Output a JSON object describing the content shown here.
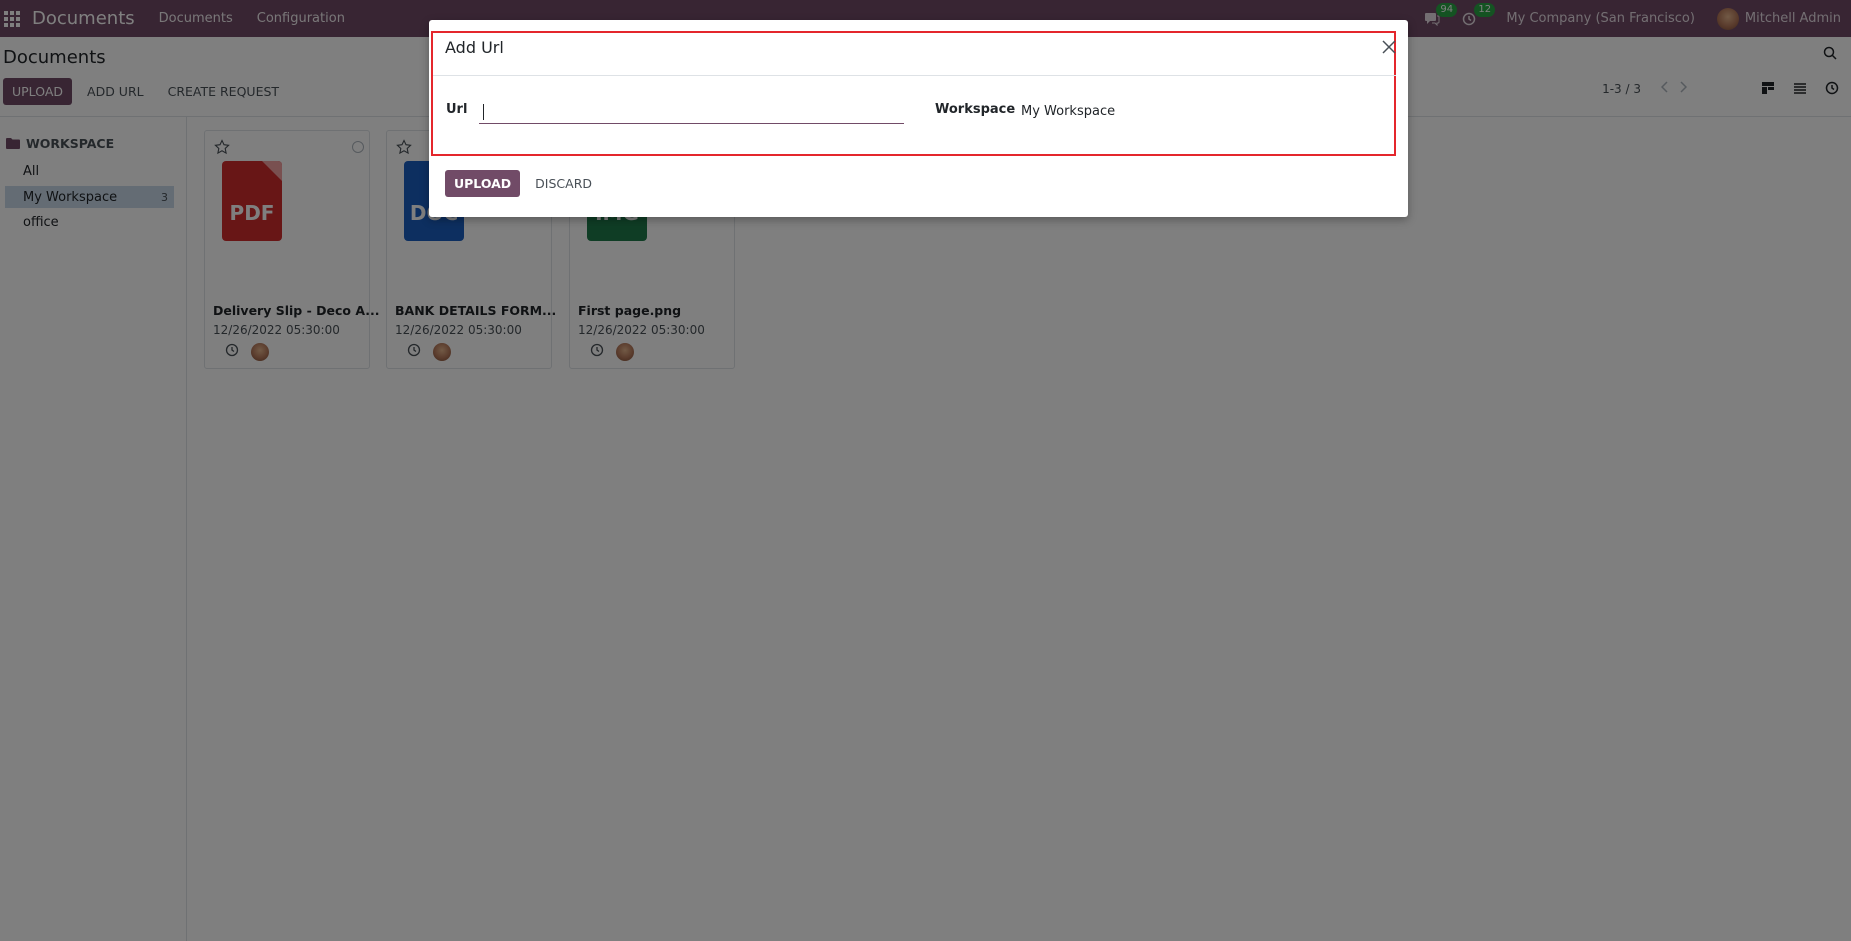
{
  "navbar": {
    "app_title": "Documents",
    "menu": [
      "Documents",
      "Configuration"
    ],
    "messages_count": "94",
    "activities_count": "12",
    "company": "My Company (San Francisco)",
    "user": "Mitchell Admin",
    "bg_color": "#714b67"
  },
  "control_panel": {
    "title": "Documents",
    "buttons": {
      "upload": "UPLOAD",
      "add_url": "ADD URL",
      "create_request": "CREATE REQUEST"
    },
    "pager": "1-3 / 3"
  },
  "sidebar": {
    "header": "WORKSPACE",
    "items": [
      {
        "label": "All",
        "count": ""
      },
      {
        "label": "My Workspace",
        "count": "3"
      },
      {
        "label": "office",
        "count": ""
      }
    ]
  },
  "cards": [
    {
      "name": "Delivery Slip - Deco A...",
      "date": "12/26/2022 05:30:00",
      "type_label": "PDF",
      "color": "#d12c2c"
    },
    {
      "name": "BANK DETAILS FORM...",
      "date": "12/26/2022 05:30:00",
      "type_label": "DOC",
      "color": "#1b5fc1"
    },
    {
      "name": "First page.png",
      "date": "12/26/2022 05:30:00",
      "type_label": "IMG",
      "color": "#1f7a4b"
    }
  ],
  "modal": {
    "title": "Add Url",
    "url_label": "Url",
    "url_value": "",
    "workspace_label": "Workspace",
    "workspace_value": "My Workspace",
    "upload_button": "UPLOAD",
    "discard_button": "DISCARD",
    "highlight_color": "#e4262c"
  }
}
